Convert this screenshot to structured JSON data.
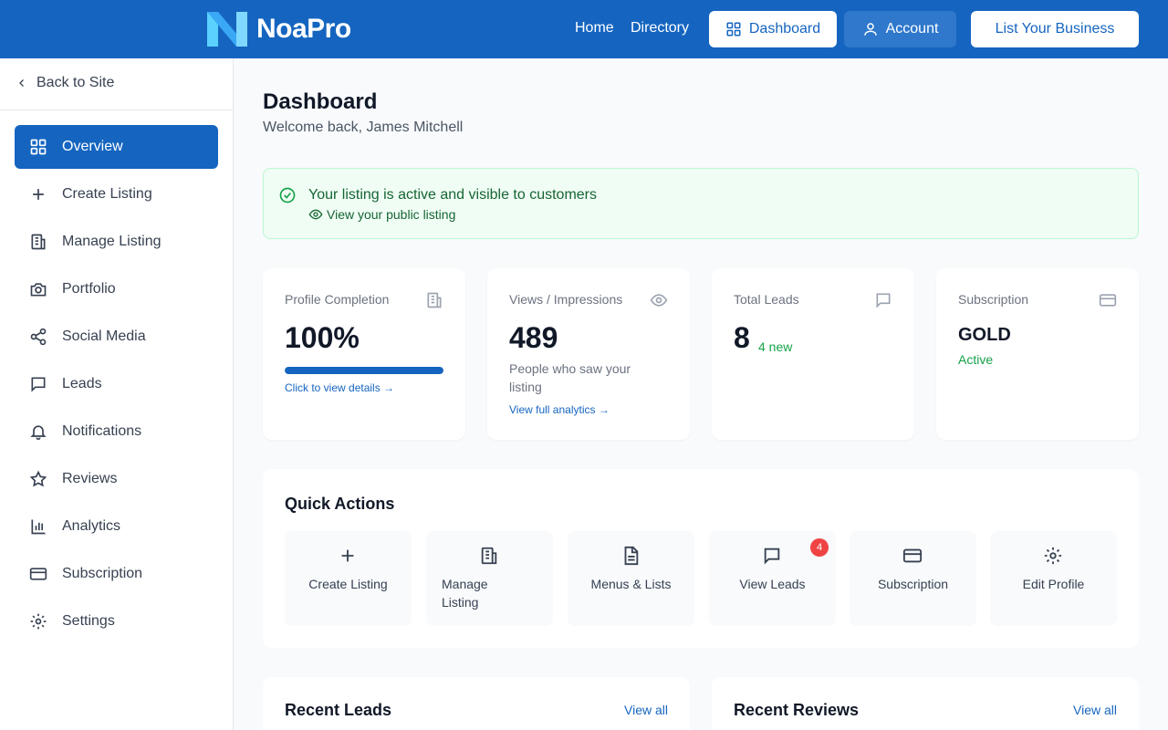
{
  "header": {
    "brand": "NoaPro",
    "nav": {
      "home": "Home",
      "directory": "Directory"
    },
    "dashboard_btn": "Dashboard",
    "account_btn": "Account",
    "list_business_btn": "List Your Business"
  },
  "sidebar": {
    "back": "Back to Site",
    "items": [
      {
        "label": "Overview",
        "icon": "grid-icon",
        "active": true
      },
      {
        "label": "Create Listing",
        "icon": "plus-icon"
      },
      {
        "label": "Manage Listing",
        "icon": "building-icon"
      },
      {
        "label": "Portfolio",
        "icon": "camera-icon"
      },
      {
        "label": "Social Media",
        "icon": "share-icon"
      },
      {
        "label": "Leads",
        "icon": "message-icon"
      },
      {
        "label": "Notifications",
        "icon": "bell-icon"
      },
      {
        "label": "Reviews",
        "icon": "star-icon"
      },
      {
        "label": "Analytics",
        "icon": "bar-chart-icon"
      },
      {
        "label": "Subscription",
        "icon": "credit-card-icon"
      },
      {
        "label": "Settings",
        "icon": "gear-icon"
      }
    ]
  },
  "main": {
    "title": "Dashboard",
    "welcome": "Welcome back, James Mitchell",
    "alert": {
      "title": "Your listing is active and visible to customers",
      "link": "View your public listing"
    },
    "stats": {
      "profile": {
        "label": "Profile Completion",
        "value": "100%",
        "progress": 1.0,
        "link": "Click to view details →"
      },
      "views": {
        "label": "Views / Impressions",
        "value": "489",
        "sub": "People who saw your listing",
        "link": "View full analytics →"
      },
      "leads": {
        "label": "Total Leads",
        "value": "8",
        "new": "4 new"
      },
      "subscription": {
        "label": "Subscription",
        "plan": "GOLD",
        "status": "Active"
      }
    },
    "quick_actions": {
      "title": "Quick Actions",
      "items": [
        {
          "label": "Create Listing",
          "icon": "plus-icon"
        },
        {
          "label": "Manage Listing",
          "icon": "building-icon"
        },
        {
          "label": "Menus & Lists",
          "icon": "document-icon"
        },
        {
          "label": "View Leads",
          "icon": "message-icon",
          "badge": "4"
        },
        {
          "label": "Subscription",
          "icon": "credit-card-icon"
        },
        {
          "label": "Edit Profile",
          "icon": "gear-icon"
        }
      ]
    },
    "recent_leads": {
      "title": "Recent Leads",
      "link": "View all"
    },
    "recent_reviews": {
      "title": "Recent Reviews",
      "link": "View all"
    }
  },
  "colors": {
    "primary": "#1565c0",
    "success": "#16a34a",
    "danger": "#ef4444"
  }
}
